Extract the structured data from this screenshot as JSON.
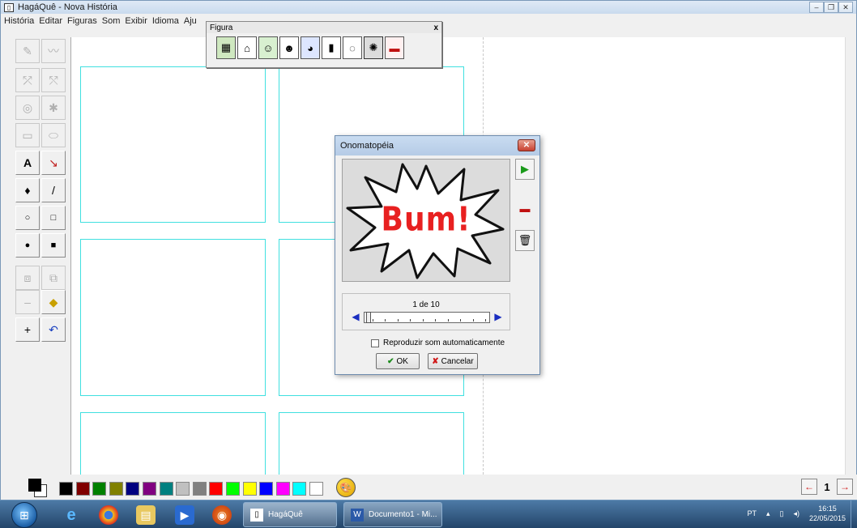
{
  "window": {
    "title": "HagáQuê - Nova História",
    "controls": [
      "–",
      "❐",
      "✕"
    ]
  },
  "menu": [
    "História",
    "Editar",
    "Figuras",
    "Som",
    "Exibir",
    "Idioma",
    "Aju"
  ],
  "figura_toolbar": {
    "title": "Figura",
    "close": "x",
    "icons": [
      "scene-icon",
      "background-icon",
      "character-icon",
      "people-icon",
      "object-icon",
      "bottle-icon",
      "speech-balloon-icon",
      "onomatopoeia-icon",
      "truck-icon"
    ]
  },
  "tools": [
    "brush-icon",
    "curve-icon",
    "flip-horizontal-icon",
    "flip-vertical-icon",
    "rotate-icon",
    "zoom-icon",
    "transparency-icon",
    "fill-icon",
    "text-icon",
    "pen-icon",
    "paint-bucket-icon",
    "line-icon",
    "ellipse-icon",
    "rectangle-icon",
    "filled-ellipse-icon",
    "filled-rectangle-icon",
    "move-front-icon",
    "move-back-icon",
    "dash-icon",
    "eraser-icon",
    "crosshair-icon",
    "undo-icon"
  ],
  "tool_labels": {
    "text": "A"
  },
  "dialog": {
    "title": "Onomatopéia",
    "close": "✕",
    "preview_text": "Bum!",
    "counter": "1 de 10",
    "checkbox_label": "Reproduzir som automaticamente",
    "ok_label": "OK",
    "cancel_label": "Cancelar",
    "side_buttons": [
      "play-icon",
      "truck-icon",
      "trash-icon"
    ]
  },
  "colors": [
    "#000000",
    "#800000",
    "#008000",
    "#808000",
    "#000080",
    "#800080",
    "#008080",
    "#c0c0c0",
    "#808080",
    "#ff0000",
    "#00ff00",
    "#ffff00",
    "#0000ff",
    "#ff00ff",
    "#00ffff",
    "#ffffff"
  ],
  "pager": {
    "page": "1"
  },
  "taskbar": {
    "tasks": [
      {
        "label": "HagáQuê"
      },
      {
        "label": "Documento1 - Mi..."
      }
    ],
    "tray_lang": "PT",
    "time": "16:15",
    "date": "22/05/2015"
  }
}
